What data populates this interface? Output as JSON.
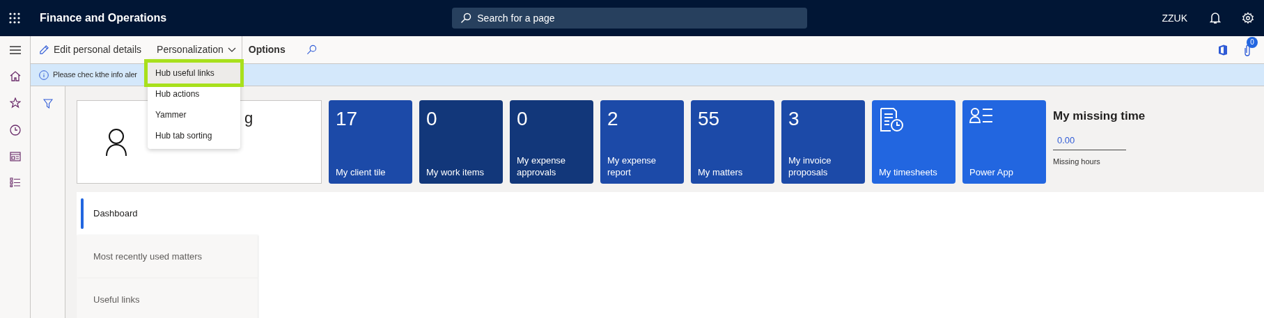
{
  "header": {
    "title": "Finance and Operations",
    "search": {
      "placeholder": "Search for a page"
    },
    "company": "ZZUK"
  },
  "toolbar": {
    "items": [
      {
        "kind": "edit",
        "label": "Edit personal details"
      },
      {
        "kind": "menu",
        "label": "Personalization",
        "expanded": true
      },
      {
        "kind": "bold",
        "label": "Options"
      }
    ],
    "attachments_count": "0"
  },
  "info_bar": {
    "message": "Please chec kthe info aler"
  },
  "personalization_menu": [
    {
      "label": "Hub useful links",
      "selected": true
    },
    {
      "label": "Hub actions",
      "selected": false
    },
    {
      "label": "Yammer",
      "selected": false
    },
    {
      "label": "Hub tab sorting",
      "selected": false
    }
  ],
  "profile": {
    "name_visible": "g"
  },
  "tiles": [
    {
      "kind": "count",
      "count": "17",
      "label": "My client tile",
      "color": "#1c4aa8"
    },
    {
      "kind": "count",
      "count": "0",
      "label": "My work items",
      "color": "#12377a"
    },
    {
      "kind": "count",
      "count": "0",
      "label": "My expense approvals",
      "color": "#12377a"
    },
    {
      "kind": "count",
      "count": "2",
      "label": "My expense report",
      "color": "#1c4aa8"
    },
    {
      "kind": "count",
      "count": "55",
      "label": "My matters",
      "color": "#1c4aa8"
    },
    {
      "kind": "count",
      "count": "3",
      "label": "My invoice proposals",
      "color": "#1c4aa8"
    },
    {
      "kind": "timesheet",
      "label": "My timesheets",
      "color": "#2266e0"
    },
    {
      "kind": "people",
      "label": "Power App",
      "color": "#2266e0"
    }
  ],
  "missing_time": {
    "title": "My missing time",
    "value": "0.00",
    "caption": "Missing hours"
  },
  "tabs": [
    {
      "label": "Dashboard",
      "selected": true
    },
    {
      "label": "Most recently used matters",
      "selected": false
    },
    {
      "label": "Useful links",
      "selected": false
    }
  ]
}
